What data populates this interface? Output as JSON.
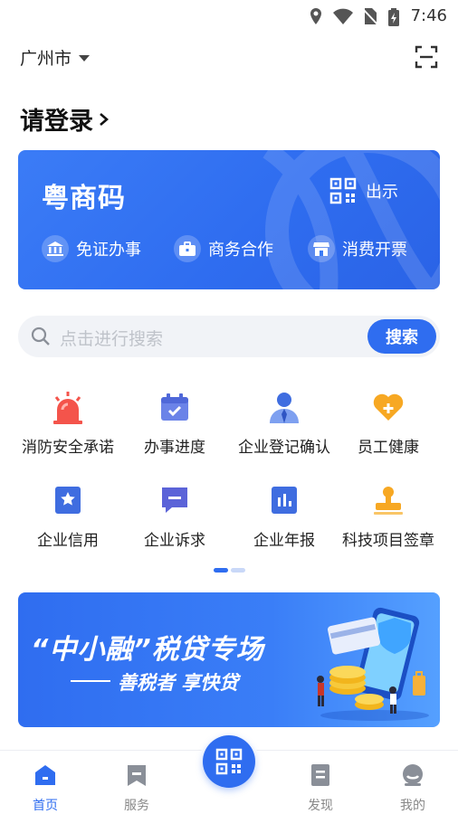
{
  "status_bar": {
    "time": "7:46"
  },
  "header": {
    "city": "广州市"
  },
  "login": {
    "label": "请登录"
  },
  "card": {
    "title": "粤商码",
    "show_label": "出示",
    "features": [
      "免证办事",
      "商务合作",
      "消费开票"
    ]
  },
  "search": {
    "placeholder": "点击进行搜索",
    "button": "搜索"
  },
  "grid": {
    "items": [
      {
        "label": "消防安全承诺",
        "icon": "alarm-icon"
      },
      {
        "label": "办事进度",
        "icon": "calendar-check-icon"
      },
      {
        "label": "企业登记确认",
        "icon": "person-icon"
      },
      {
        "label": "员工健康",
        "icon": "heart-plus-icon"
      },
      {
        "label": "企业信用",
        "icon": "star-badge-icon"
      },
      {
        "label": "企业诉求",
        "icon": "chat-icon"
      },
      {
        "label": "企业年报",
        "icon": "bar-report-icon"
      },
      {
        "label": "科技项目签章",
        "icon": "stamp-icon"
      }
    ]
  },
  "banner": {
    "title": "“中小融”税贷专场",
    "subtitle": "善税者 享快贷"
  },
  "nav": {
    "items": [
      {
        "label": "首页",
        "active": true
      },
      {
        "label": "服务"
      },
      {
        "label": "发现"
      },
      {
        "label": "我的"
      }
    ]
  },
  "colors": {
    "primary": "#2f6df0",
    "accent_red": "#f4544b",
    "accent_orange": "#f7a823",
    "indicator_inactive": "#c9d8f8"
  }
}
